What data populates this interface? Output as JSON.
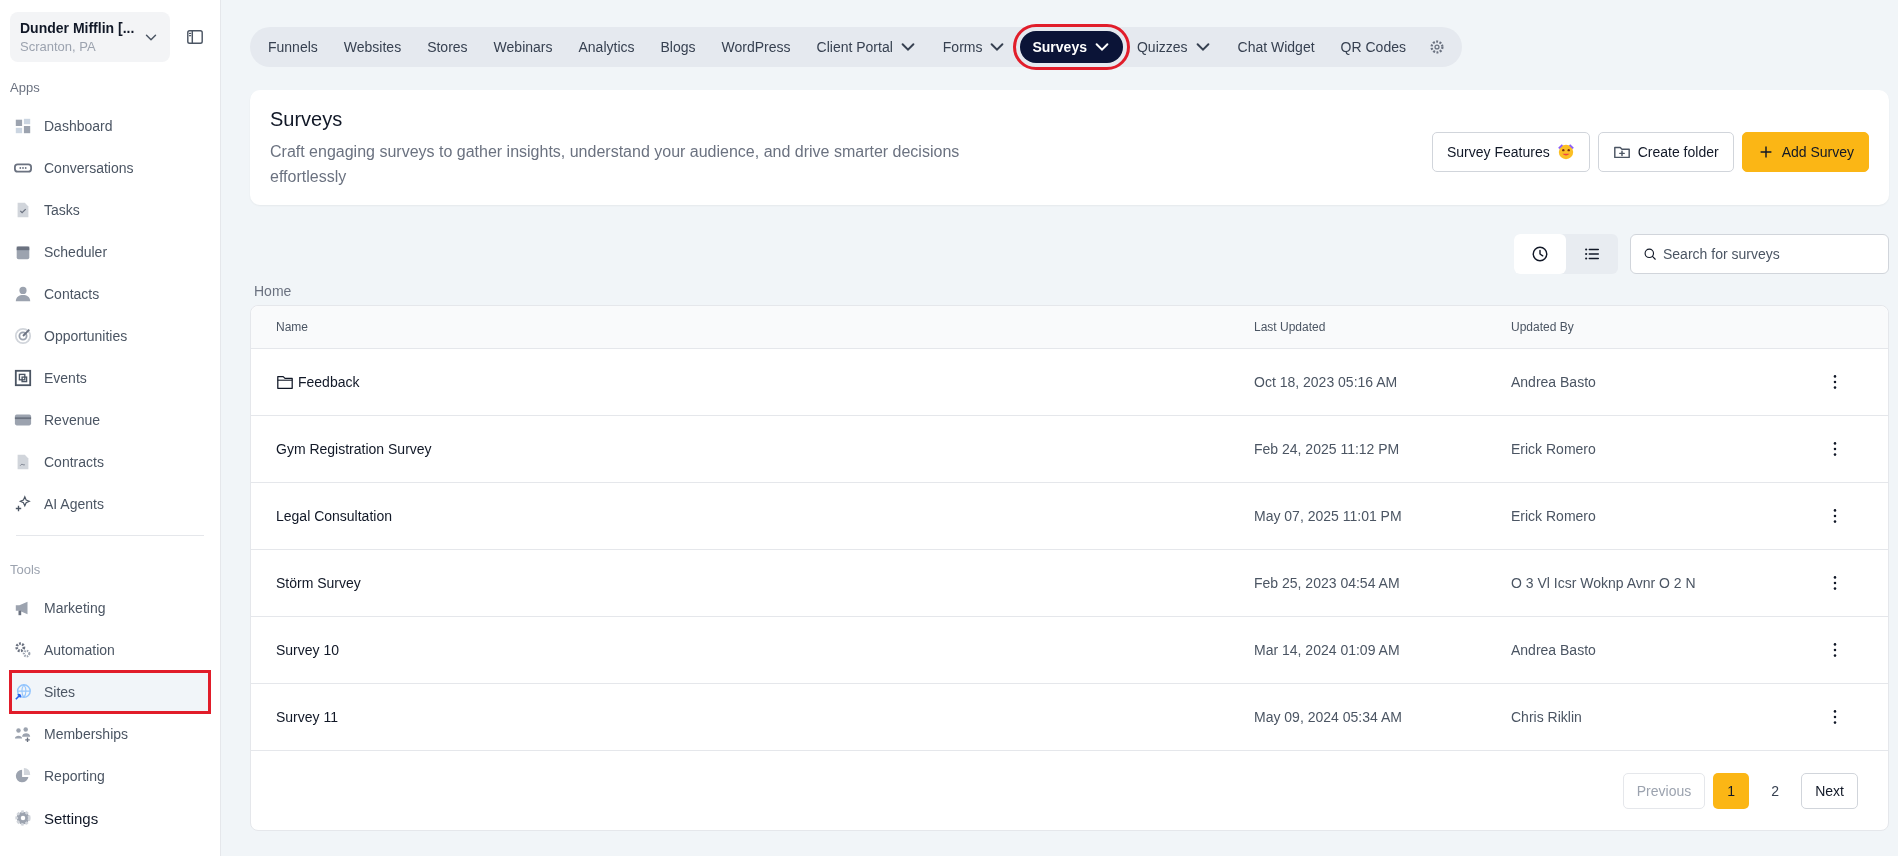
{
  "sidebar": {
    "account": {
      "name": "Dunder Mifflin [...",
      "location": "Scranton, PA"
    },
    "sections": [
      {
        "title": "Apps",
        "items": [
          {
            "label": "Dashboard",
            "selected": false,
            "highlighted": false
          },
          {
            "label": "Conversations",
            "selected": false,
            "highlighted": false
          },
          {
            "label": "Tasks",
            "selected": false,
            "highlighted": false
          },
          {
            "label": "Scheduler",
            "selected": false,
            "highlighted": false
          },
          {
            "label": "Contacts",
            "selected": false,
            "highlighted": false
          },
          {
            "label": "Opportunities",
            "selected": false,
            "highlighted": false
          },
          {
            "label": "Events",
            "selected": false,
            "highlighted": false
          },
          {
            "label": "Revenue",
            "selected": false,
            "highlighted": false
          },
          {
            "label": "Contracts",
            "selected": false,
            "highlighted": false
          },
          {
            "label": "AI Agents",
            "selected": false,
            "highlighted": false
          }
        ]
      },
      {
        "title": "Tools",
        "items": [
          {
            "label": "Marketing",
            "selected": false,
            "highlighted": false
          },
          {
            "label": "Automation",
            "selected": false,
            "highlighted": false
          },
          {
            "label": "Sites",
            "selected": true,
            "highlighted": true
          },
          {
            "label": "Memberships",
            "selected": false,
            "highlighted": false
          },
          {
            "label": "Reporting",
            "selected": false,
            "highlighted": false
          }
        ]
      }
    ],
    "footer_item": {
      "label": "Settings"
    }
  },
  "nav_tabs": [
    {
      "label": "Funnels",
      "dropdown": false,
      "selected": false,
      "highlighted": false
    },
    {
      "label": "Websites",
      "dropdown": false,
      "selected": false,
      "highlighted": false
    },
    {
      "label": "Stores",
      "dropdown": false,
      "selected": false,
      "highlighted": false
    },
    {
      "label": "Webinars",
      "dropdown": false,
      "selected": false,
      "highlighted": false
    },
    {
      "label": "Analytics",
      "dropdown": false,
      "selected": false,
      "highlighted": false
    },
    {
      "label": "Blogs",
      "dropdown": false,
      "selected": false,
      "highlighted": false
    },
    {
      "label": "WordPress",
      "dropdown": false,
      "selected": false,
      "highlighted": false
    },
    {
      "label": "Client Portal",
      "dropdown": true,
      "selected": false,
      "highlighted": false
    },
    {
      "label": "Forms",
      "dropdown": true,
      "selected": false,
      "highlighted": false
    },
    {
      "label": "Surveys",
      "dropdown": true,
      "selected": true,
      "highlighted": true
    },
    {
      "label": "Quizzes",
      "dropdown": true,
      "selected": false,
      "highlighted": false
    },
    {
      "label": "Chat Widget",
      "dropdown": false,
      "selected": false,
      "highlighted": false
    },
    {
      "label": "QR Codes",
      "dropdown": false,
      "selected": false,
      "highlighted": false
    }
  ],
  "header": {
    "title": "Surveys",
    "description": "Craft engaging surveys to gather insights, understand your audience, and drive smarter decisions effortlessly",
    "buttons": [
      {
        "label": "Survey Features",
        "kind": "features"
      },
      {
        "label": "Create folder",
        "kind": "folder"
      },
      {
        "label": "Add Survey",
        "kind": "primary"
      }
    ]
  },
  "view_toggle": [
    {
      "kind": "recent",
      "selected": true
    },
    {
      "kind": "list",
      "selected": false
    }
  ],
  "search": {
    "placeholder": "Search for surveys"
  },
  "breadcrumb": "Home",
  "table": {
    "columns": [
      "Name",
      "Last Updated",
      "Updated By"
    ],
    "rows": [
      {
        "kind": "folder",
        "name": "Feedback",
        "last_updated": "Oct 18, 2023 05:16 AM",
        "updated_by": "Andrea Basto"
      },
      {
        "kind": "survey",
        "name": "Gym Registration Survey",
        "last_updated": "Feb 24, 2025 11:12 PM",
        "updated_by": "Erick Romero"
      },
      {
        "kind": "survey",
        "name": "Legal Consultation",
        "last_updated": "May 07, 2025 11:01 PM",
        "updated_by": "Erick Romero"
      },
      {
        "kind": "survey",
        "name": "Störm Survey",
        "last_updated": "Feb 25, 2023 04:54 AM",
        "updated_by": "O 3 Vl Icsr Woknp Avnr O 2 N"
      },
      {
        "kind": "survey",
        "name": "Survey 10",
        "last_updated": "Mar 14, 2024 01:09 AM",
        "updated_by": "Andrea Basto"
      },
      {
        "kind": "survey",
        "name": "Survey 11",
        "last_updated": "May 09, 2024 05:34 AM",
        "updated_by": "Chris Riklin"
      }
    ]
  },
  "pagination": {
    "previous": {
      "label": "Previous",
      "disabled": true
    },
    "pages": [
      {
        "label": "1",
        "selected": true
      },
      {
        "label": "2",
        "selected": false
      }
    ],
    "next": {
      "label": "Next",
      "disabled": false
    }
  }
}
